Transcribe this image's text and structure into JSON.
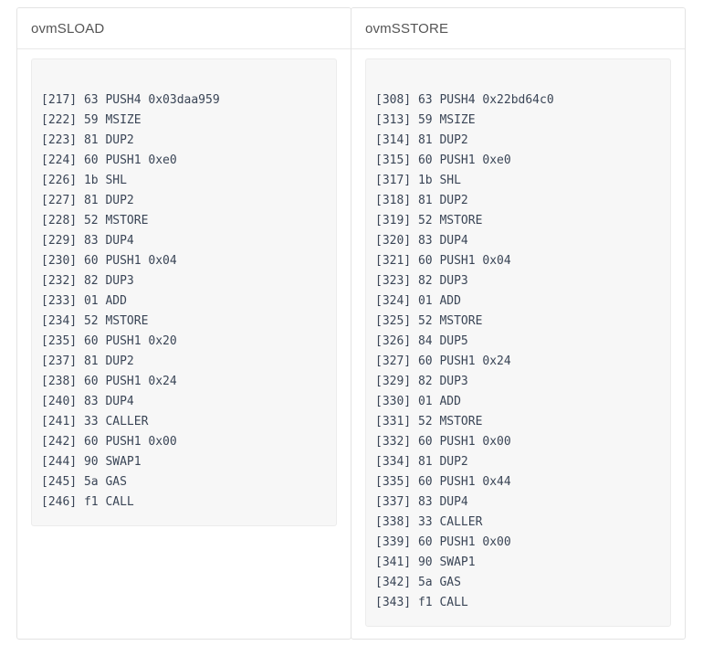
{
  "theme": {
    "page_background": "#ffffff",
    "card_border": "#e3e3e3",
    "header_divider": "#e8e8e8",
    "title_color": "#555555",
    "code_background": "#f7f7f7",
    "code_border": "#ececec",
    "code_text_color": "#3a4556"
  },
  "panels": [
    {
      "title": "ovmSLOAD",
      "code_lines": [
        "[217] 63 PUSH4 0x03daa959",
        "[222] 59 MSIZE",
        "[223] 81 DUP2",
        "[224] 60 PUSH1 0xe0",
        "[226] 1b SHL",
        "[227] 81 DUP2",
        "[228] 52 MSTORE",
        "[229] 83 DUP4",
        "[230] 60 PUSH1 0x04",
        "[232] 82 DUP3",
        "[233] 01 ADD",
        "[234] 52 MSTORE",
        "[235] 60 PUSH1 0x20",
        "[237] 81 DUP2",
        "[238] 60 PUSH1 0x24",
        "[240] 83 DUP4",
        "[241] 33 CALLER",
        "[242] 60 PUSH1 0x00",
        "[244] 90 SWAP1",
        "[245] 5a GAS",
        "[246] f1 CALL"
      ]
    },
    {
      "title": "ovmSSTORE",
      "code_lines": [
        "[308] 63 PUSH4 0x22bd64c0",
        "[313] 59 MSIZE",
        "[314] 81 DUP2",
        "[315] 60 PUSH1 0xe0",
        "[317] 1b SHL",
        "[318] 81 DUP2",
        "[319] 52 MSTORE",
        "[320] 83 DUP4",
        "[321] 60 PUSH1 0x04",
        "[323] 82 DUP3",
        "[324] 01 ADD",
        "[325] 52 MSTORE",
        "[326] 84 DUP5",
        "[327] 60 PUSH1 0x24",
        "[329] 82 DUP3",
        "[330] 01 ADD",
        "[331] 52 MSTORE",
        "[332] 60 PUSH1 0x00",
        "[334] 81 DUP2",
        "[335] 60 PUSH1 0x44",
        "[337] 83 DUP4",
        "[338] 33 CALLER",
        "[339] 60 PUSH1 0x00",
        "[341] 90 SWAP1",
        "[342] 5a GAS",
        "[343] f1 CALL"
      ]
    }
  ]
}
